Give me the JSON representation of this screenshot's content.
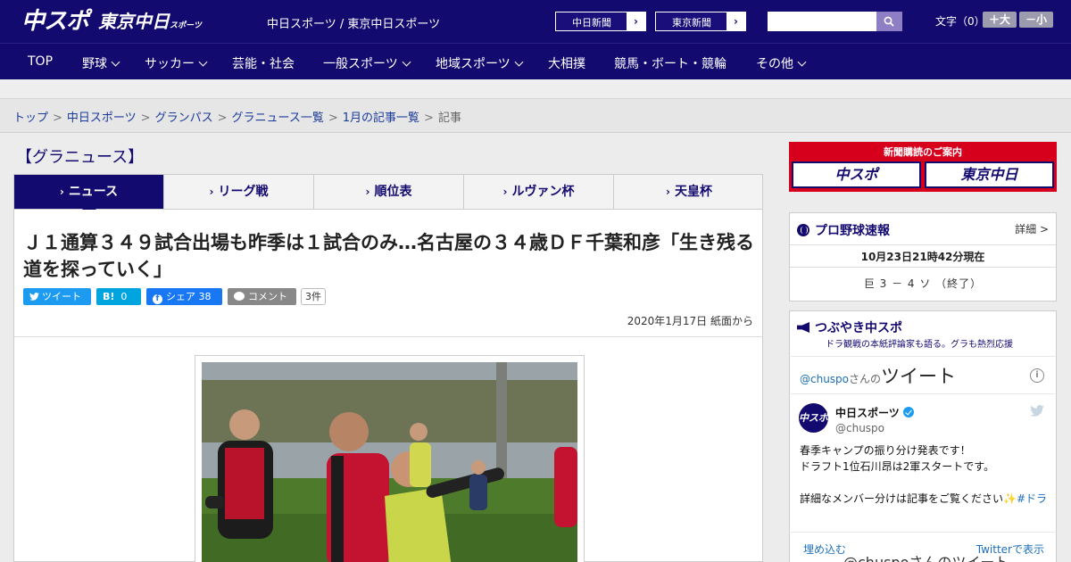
{
  "header": {
    "logo_primary": "中スポ",
    "logo_secondary": "東京中日",
    "logo_secondary_small": "スポーツ",
    "site_links": "中日スポーツ / 東京中日スポーツ",
    "paper_buttons": [
      "中日新聞",
      "東京新聞"
    ],
    "search_placeholder": "",
    "font_size_label": "文字（0）",
    "font_bigger": "＋大",
    "font_smaller": "－小"
  },
  "nav": {
    "items": [
      {
        "label": "TOP",
        "dropdown": false
      },
      {
        "label": "野球",
        "dropdown": true
      },
      {
        "label": "サッカー",
        "dropdown": true
      },
      {
        "label": "芸能・社会",
        "dropdown": false
      },
      {
        "label": "一般スポーツ",
        "dropdown": true
      },
      {
        "label": "地域スポーツ",
        "dropdown": true
      },
      {
        "label": "大相撲",
        "dropdown": false
      },
      {
        "label": "競馬・ボート・競輪",
        "dropdown": false
      },
      {
        "label": "その他",
        "dropdown": true
      }
    ]
  },
  "breadcrumb": {
    "links": [
      "トップ",
      "中日スポーツ",
      "グランパス",
      "グラニュース一覧",
      "1月の記事一覧"
    ],
    "current": "記事",
    "separator": ">"
  },
  "section": {
    "title": "【グラニュース】",
    "tabs": [
      "ニュース",
      "リーグ戦",
      "順位表",
      "ルヴァン杯",
      "天皇杯"
    ],
    "active_tab": 0
  },
  "article": {
    "headline": "Ｊ１通算３４９試合出場も昨季は１試合のみ…名古屋の３４歳ＤＦ千葉和彦「生き残る道を探っていく」",
    "share": {
      "tweet": "ツイート",
      "hatena_label": "B!",
      "hatena_count": "0",
      "facebook_label": "シェア",
      "facebook_count": "38",
      "comment_label": "コメント",
      "comment_count": "3件"
    },
    "date": "2020年1月17日 紙面から"
  },
  "sidebar": {
    "subscription": {
      "caption": "新聞購読のご案内",
      "left": "中スポ",
      "right": "東京中日"
    },
    "baseball": {
      "title": "プロ野球速報",
      "detail": "詳細 >",
      "time": "10月23日21時42分現在",
      "score": "巨 3 － 4 ソ （終了）"
    },
    "tweets": {
      "title": "つぶやき中スポ",
      "subtitle": "ドラ観戦の本紙評論家も語る。グラも熱烈応援",
      "feed_handle": "@chuspo",
      "feed_suffix": "さんの",
      "feed_title": "ツイート",
      "account_name": "中日スポーツ",
      "account_handle": "@chuspo",
      "avatar_text": "中スポ",
      "body_lines": [
        "春季キャンプの振り分け発表です！",
        "ドラフト1位石川昂は2軍スタートです。",
        "",
        "詳細なメンバー分けは記事をご覧ください✨"
      ],
      "hashtag": "#ドラ",
      "embed": "埋め込む",
      "view_on_twitter": "Twitterで表示",
      "bottom_text": "@chuspoさんのツイート"
    }
  },
  "colors": {
    "brand_navy": "#130a6f",
    "brand_red": "#d6001c",
    "twitter": "#1d9bf0",
    "facebook": "#1877f2"
  }
}
